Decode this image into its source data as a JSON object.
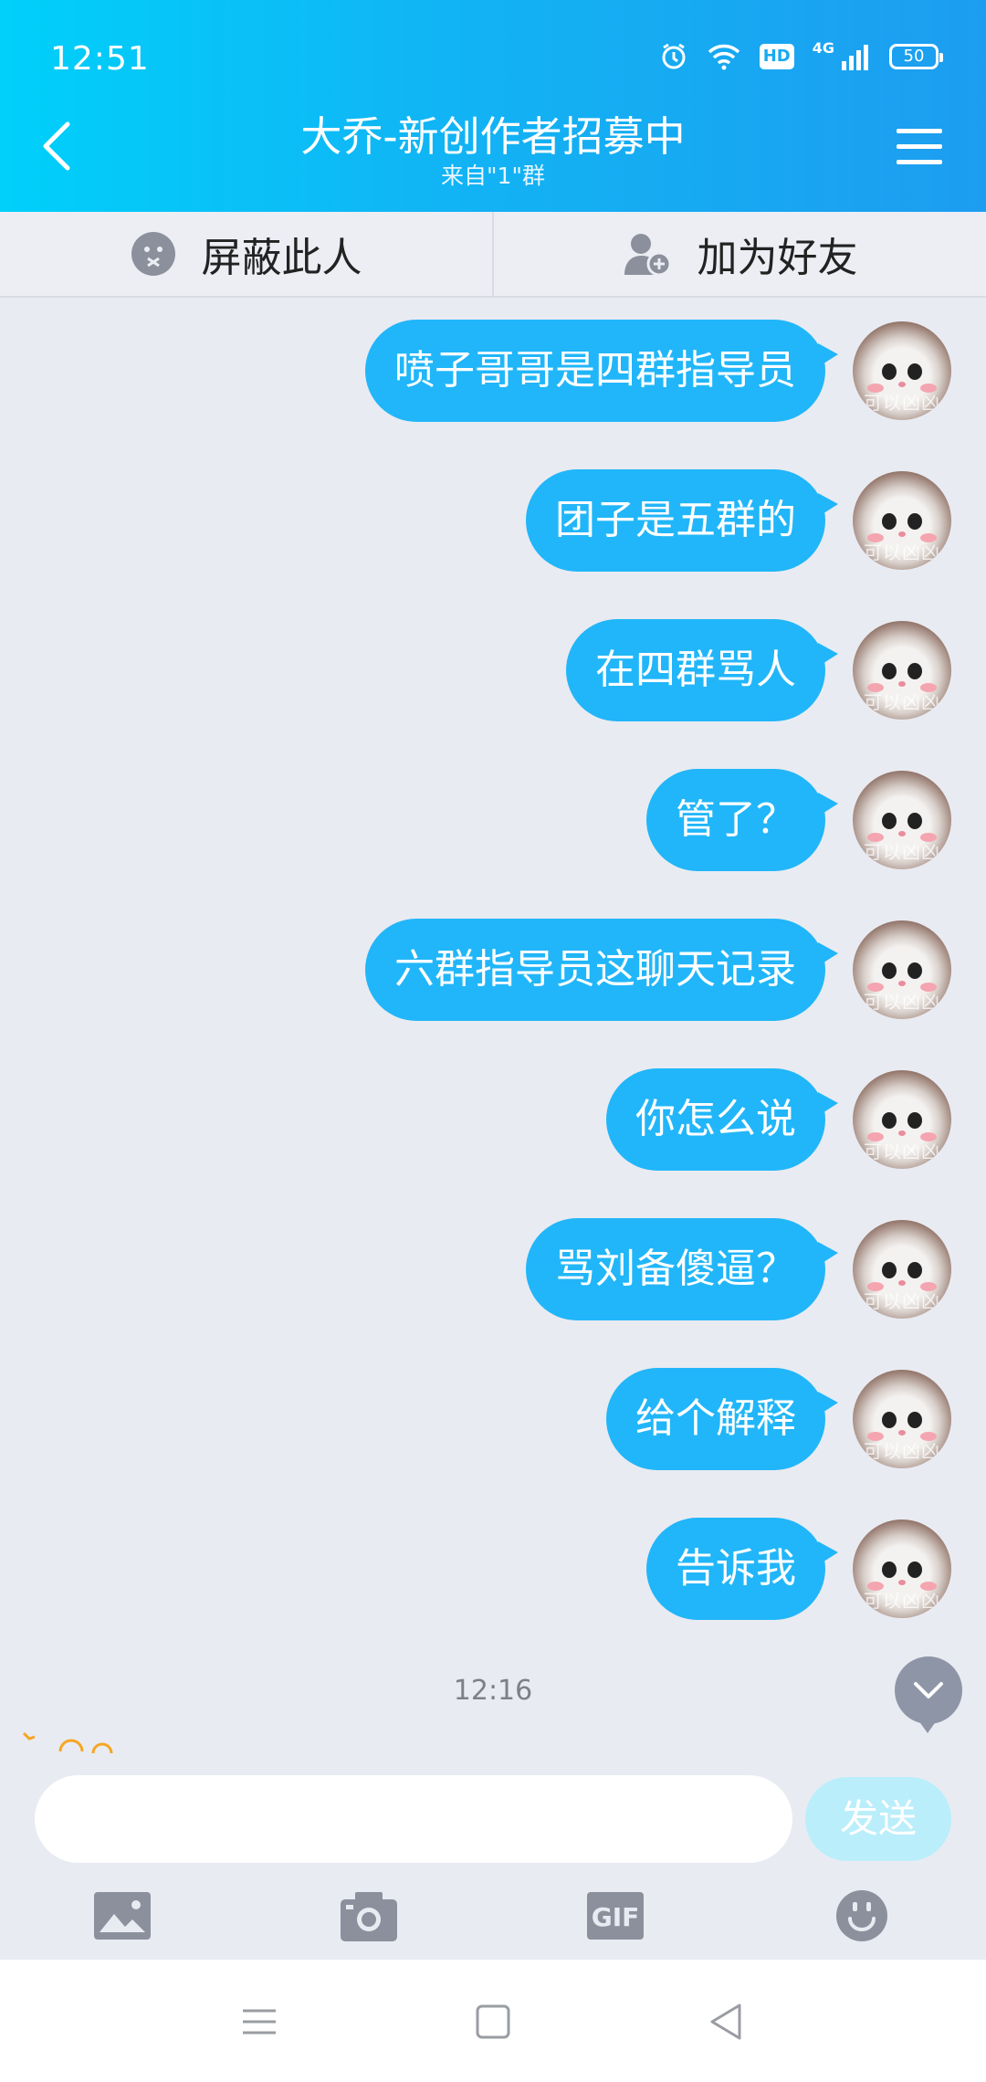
{
  "status_bar": {
    "time": "12:51",
    "hd": "HD",
    "network": "4G",
    "battery": "50"
  },
  "header": {
    "title": "大乔-新创作者招募中",
    "subtitle": "来自\"1\"群"
  },
  "actions": {
    "block_label": "屏蔽此人",
    "add_friend_label": "加为好友"
  },
  "messages": [
    {
      "text": "喷子哥哥是四群指导员"
    },
    {
      "text": "团子是五群的"
    },
    {
      "text": "在四群骂人"
    },
    {
      "text": "管了？"
    },
    {
      "text": "六群指导员这聊天记录"
    },
    {
      "text": "你怎么说"
    },
    {
      "text": "骂刘备傻逼？"
    },
    {
      "text": "给个解释"
    },
    {
      "text": "告诉我"
    }
  ],
  "avatar_watermark": "可以凶凶",
  "timestamp": "12:16",
  "input": {
    "value": "",
    "send_label": "发送"
  },
  "colors": {
    "header_start": "#00d0fa",
    "header_end": "#1d9df0",
    "bubble": "#21b6f9",
    "send_disabled": "#baeefb"
  }
}
